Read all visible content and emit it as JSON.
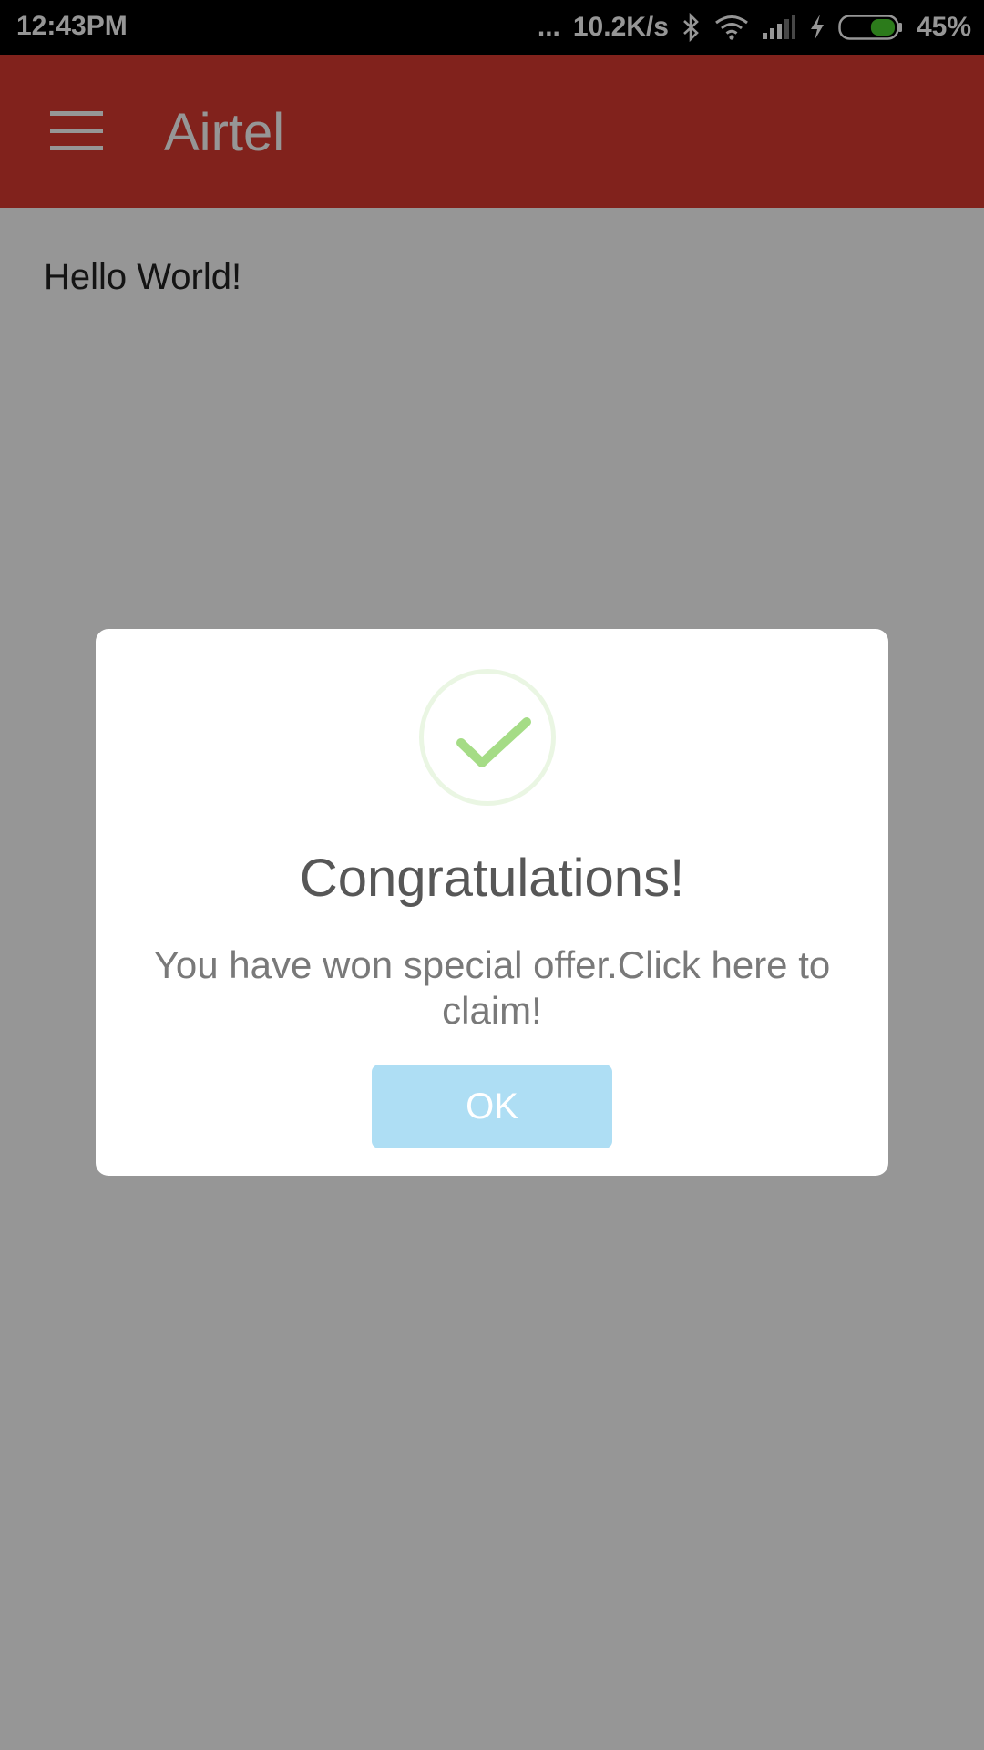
{
  "status_bar": {
    "time": "12:43PM",
    "more_indicator": "...",
    "network_speed": "10.2K/s",
    "battery_percent": "45%",
    "battery_level": 0.45,
    "icons": [
      "bluetooth-icon",
      "wifi-icon",
      "signal-icon",
      "charging-icon",
      "battery-icon"
    ]
  },
  "app_bar": {
    "title": "Airtel",
    "menu_icon": "hamburger-menu-icon",
    "color": "#db3a31"
  },
  "content": {
    "text": "Hello World!"
  },
  "dialog": {
    "icon": "success-check-icon",
    "title": "Congratulations!",
    "message": "You have won special offer.Click here to claim!",
    "ok_label": "OK",
    "button_color": "#aedef4",
    "check_color": "#a5dc86"
  }
}
